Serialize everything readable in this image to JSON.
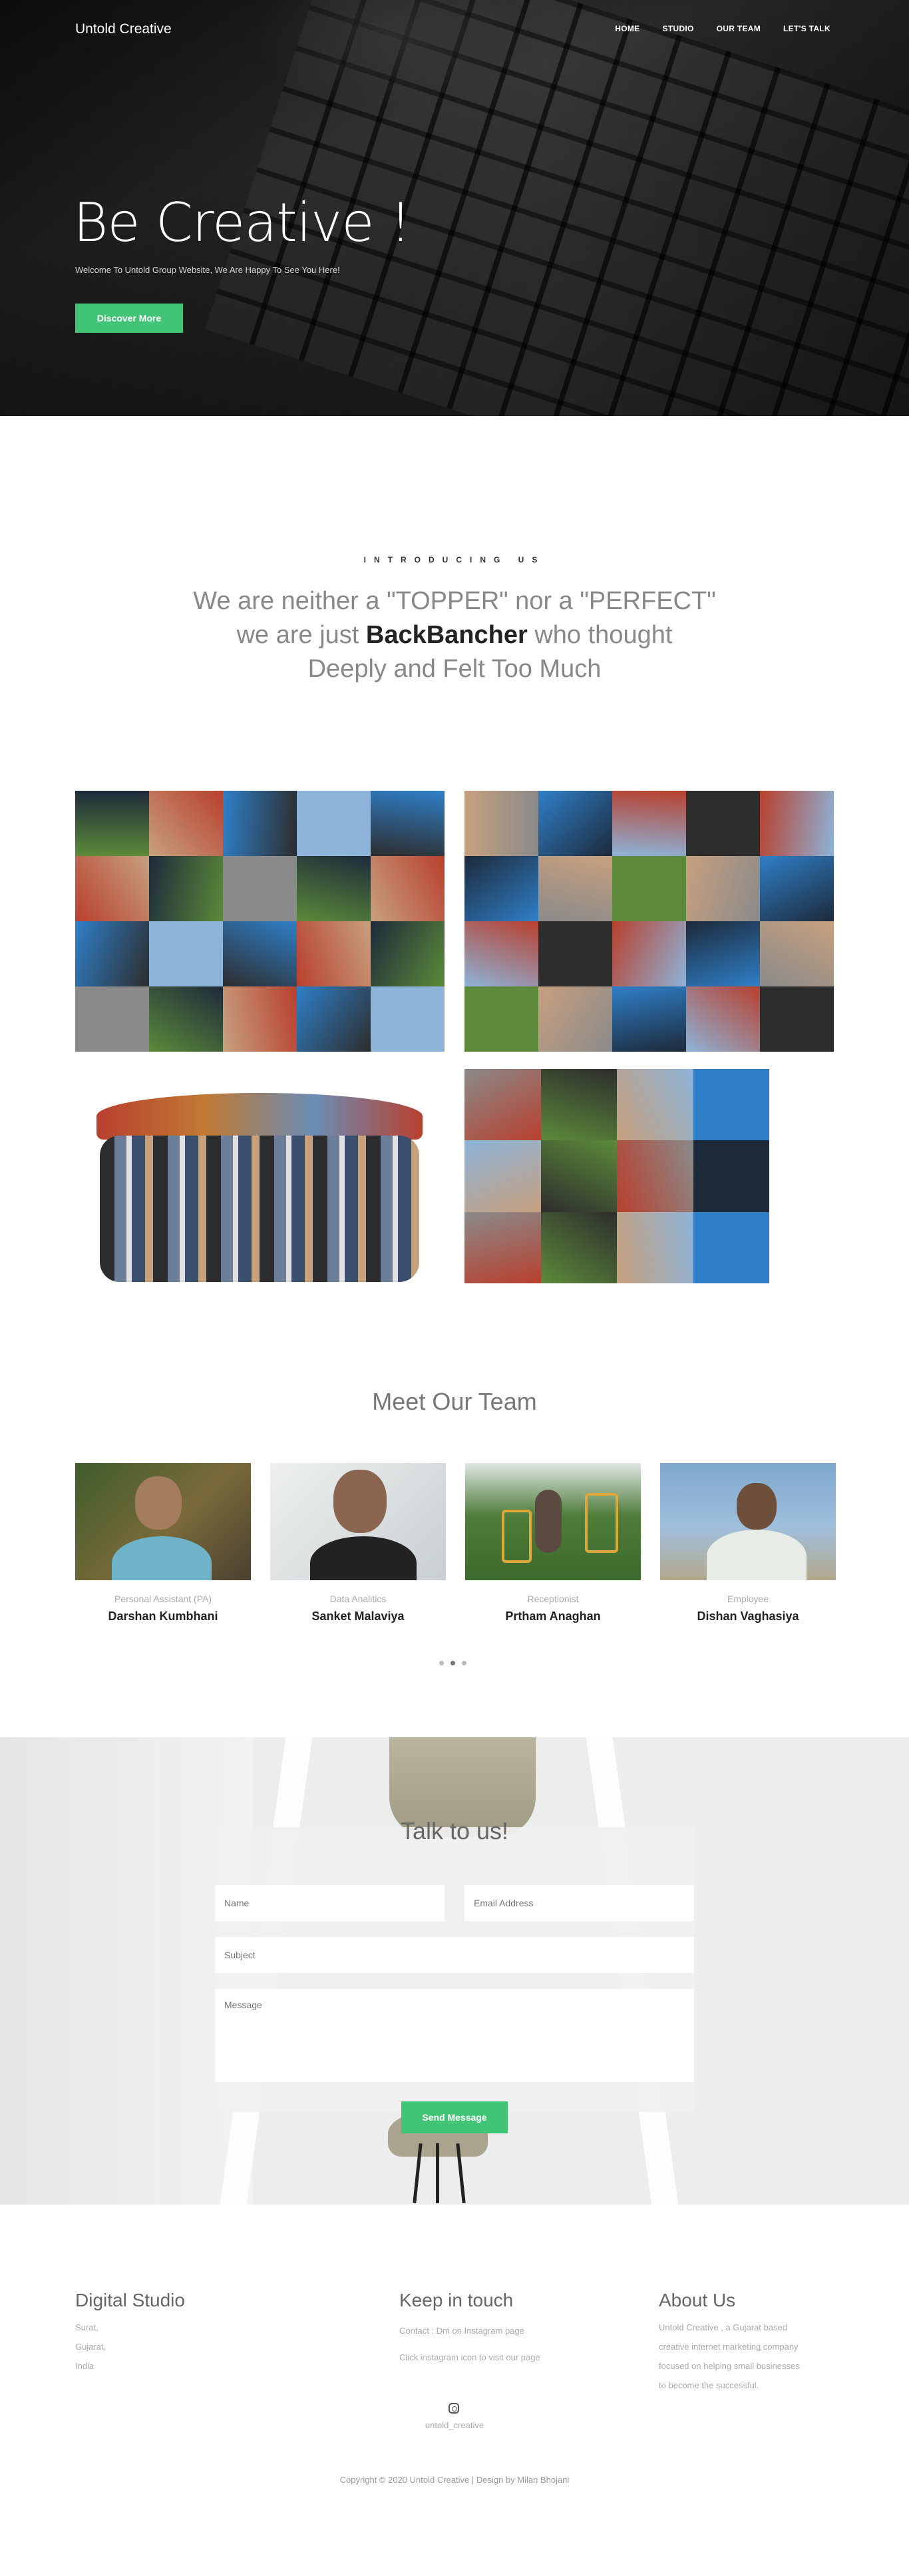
{
  "header": {
    "brand": "Untold Creative",
    "nav": [
      "HOME",
      "STUDIO",
      "OUR TEAM",
      "LET'S TALK"
    ]
  },
  "hero": {
    "title": "Be Creative !",
    "subtitle": "Welcome To Untold Group Website, We Are Happy To See You Here!",
    "button": "Discover More"
  },
  "intro": {
    "kicker": "INTRODUCING US",
    "line1": "We are neither a \"TOPPER\" nor a \"PERFECT\"",
    "line2_pre": "we are just ",
    "line2_bold": "BackBancher",
    "line2_post": " who thought",
    "line3": "Deeply and Felt Too Much"
  },
  "gallery": {
    "colors": {
      "green": "#5c8a3a",
      "sky": "#8db3d8",
      "night": "#1d2a3a",
      "skin": "#c7a07e",
      "dark": "#2d2d2d",
      "gray": "#8a8a8a",
      "blue": "#2f7fc8",
      "red": "#b8402e"
    }
  },
  "team": {
    "title": "Meet Our Team",
    "members": [
      {
        "role": "Personal Assistant (PA)",
        "name": "Darshan Kumbhani"
      },
      {
        "role": "Data Analitics",
        "name": "Sanket Malaviya"
      },
      {
        "role": "Receptionist",
        "name": "Prtham Anaghan"
      },
      {
        "role": "Employee",
        "name": "Dishan Vaghasiya"
      }
    ],
    "slider_active_index": 1
  },
  "contact": {
    "title": "Talk to us!",
    "name_placeholder": "Name",
    "email_placeholder": "Email Address",
    "subject_placeholder": "Subject",
    "message_placeholder": "Message",
    "send": "Send Message"
  },
  "footer": {
    "col1_title": "Digital Studio",
    "col1_lines": [
      "Surat,",
      "Gujarat,",
      "India"
    ],
    "col2_title": "Keep in touch",
    "col2_lines": [
      "Contact : Dm on Instagram page",
      "Click instagram icon to visit our page"
    ],
    "col3_title": "About Us",
    "col3_lines": [
      "Untold Creative , a Gujarat based",
      "creative internet marketing company",
      "focused on helping small businesses",
      "to become the successful."
    ],
    "instagram_handle": "untold_creative",
    "copyright": "Copyright © 2020 Untold Creative | Design by Milan Bhojani"
  }
}
